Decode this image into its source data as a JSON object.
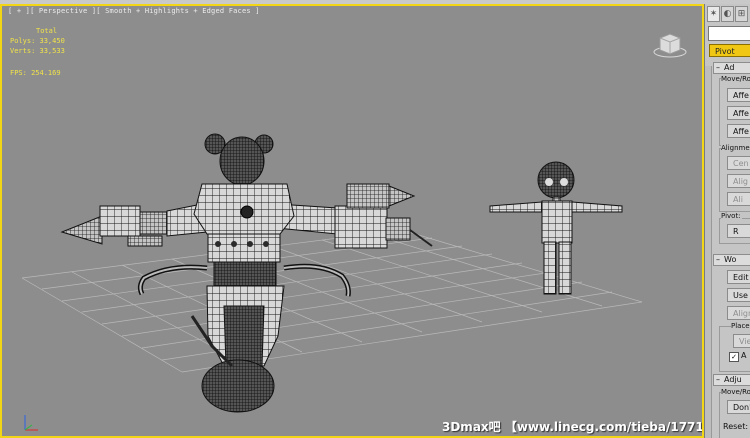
{
  "viewport": {
    "label": "[ + ][ Perspective ][ Smooth + Highlights + Edged Faces ]",
    "stats": {
      "total_label": "Total",
      "polys": "Polys: 33,450",
      "verts": "Verts: 33,533",
      "fps": "FPS:   254.169"
    },
    "viewcube_icon": "viewcube-icon",
    "axis_icon": "axis-tripod-icon",
    "watermark": "3Dmax吧 【www.linecg.com/tieba/1771】",
    "colors": {
      "active_border": "#f2d616",
      "background": "#8d8d8d",
      "wire": "#1a1a1a",
      "mesh": "#d4d4d4"
    }
  },
  "panel": {
    "tabs": [
      "create-tab",
      "modify-tab",
      "hierarchy-tab"
    ],
    "pivot_button": "Pivot",
    "rollout_adjust_pivot": "Ad",
    "group_move_rotate": "Move/Ro",
    "affect_buttons": [
      "Affe",
      "Affe",
      "Affe"
    ],
    "group_alignment": "Alignmen",
    "align_buttons": [
      "Cen",
      "Alig",
      "Ali"
    ],
    "group_pivot": "Pivot:",
    "reset_button": "R",
    "rollout_working_pivot": "Wo",
    "edit_button": "Edit W",
    "use_button": "Use W",
    "align_to_button": "Align To",
    "group_place": "Place P",
    "view_button": "View",
    "checkbox_label": "A",
    "rollout_adjust_transform": "Adju",
    "group_move_rotate_2": "Move/Ro",
    "dont_button": "Don't",
    "reset_label": "Reset:"
  }
}
